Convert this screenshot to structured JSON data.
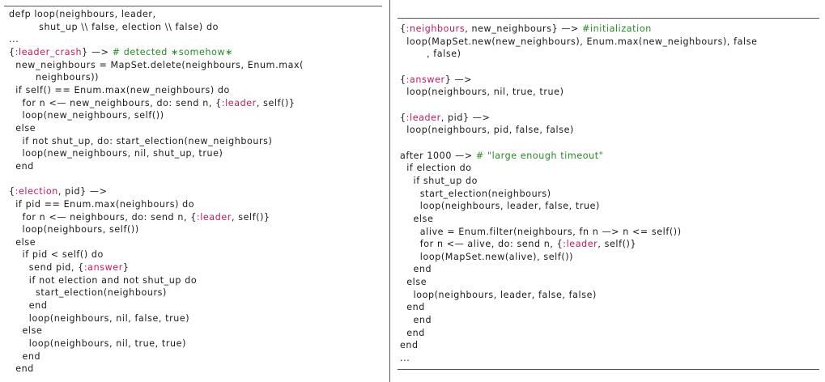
{
  "left_listing": {
    "lines": [
      [
        {
          "t": "defp loop(neighbours, leader,"
        }
      ],
      [
        {
          "t": "         shut_up \\\\ false, election \\\\ false) do"
        }
      ],
      [
        {
          "t": "..."
        }
      ],
      [
        {
          "t": "{"
        },
        {
          "t": ":leader_crash",
          "c": "atom"
        },
        {
          "t": "} —> "
        },
        {
          "t": "# detected ∗somehow∗",
          "c": "cm"
        }
      ],
      [
        {
          "t": "  new_neighbours = MapSet.delete(neighbours, Enum.max("
        }
      ],
      [
        {
          "t": "        neighbours))"
        }
      ],
      [
        {
          "t": "  if self() == Enum.max(new_neighbours) do"
        }
      ],
      [
        {
          "t": "    for n <— new_neighbours, do: send n, {"
        },
        {
          "t": ":leader",
          "c": "atom"
        },
        {
          "t": ", self()}"
        }
      ],
      [
        {
          "t": "    loop(new_neighbours, self())"
        }
      ],
      [
        {
          "t": "  else"
        }
      ],
      [
        {
          "t": "    if not shut_up, do: start_election(new_neighbours)"
        }
      ],
      [
        {
          "t": "    loop(new_neighbours, nil, shut_up, true)"
        }
      ],
      [
        {
          "t": "  end"
        }
      ],
      [
        {
          "t": ""
        }
      ],
      [
        {
          "t": "{"
        },
        {
          "t": ":election",
          "c": "atom"
        },
        {
          "t": ", pid} —>"
        }
      ],
      [
        {
          "t": "  if pid == Enum.max(neighbours) do"
        }
      ],
      [
        {
          "t": "    for n <— neighbours, do: send n, {"
        },
        {
          "t": ":leader",
          "c": "atom"
        },
        {
          "t": ", self()}"
        }
      ],
      [
        {
          "t": "    loop(neighbours, self())"
        }
      ],
      [
        {
          "t": "  else"
        }
      ],
      [
        {
          "t": "    if pid < self() do"
        }
      ],
      [
        {
          "t": "      send pid, {"
        },
        {
          "t": ":answer",
          "c": "atom"
        },
        {
          "t": "}"
        }
      ],
      [
        {
          "t": "      if not election and not shut_up do"
        }
      ],
      [
        {
          "t": "        start_election(neighbours)"
        }
      ],
      [
        {
          "t": "      end"
        }
      ],
      [
        {
          "t": "      loop(neighbours, nil, false, true)"
        }
      ],
      [
        {
          "t": "    else"
        }
      ],
      [
        {
          "t": "      loop(neighbours, nil, true, true)"
        }
      ],
      [
        {
          "t": "    end"
        }
      ],
      [
        {
          "t": "  end"
        }
      ]
    ]
  },
  "right_listing": {
    "lines": [
      [
        {
          "t": "{"
        },
        {
          "t": ":neighbours",
          "c": "atom"
        },
        {
          "t": ", new_neighbours} —> "
        },
        {
          "t": "#initialization",
          "c": "cm"
        }
      ],
      [
        {
          "t": "  loop(MapSet.new(new_neighbours), Enum.max(new_neighbours), false"
        }
      ],
      [
        {
          "t": "        , false)"
        }
      ],
      [
        {
          "t": ""
        }
      ],
      [
        {
          "t": "{"
        },
        {
          "t": ":answer",
          "c": "atom"
        },
        {
          "t": "} —>"
        }
      ],
      [
        {
          "t": "  loop(neighbours, nil, true, true)"
        }
      ],
      [
        {
          "t": ""
        }
      ],
      [
        {
          "t": "{"
        },
        {
          "t": ":leader",
          "c": "atom"
        },
        {
          "t": ", pid} —>"
        }
      ],
      [
        {
          "t": "  loop(neighbours, pid, false, false)"
        }
      ],
      [
        {
          "t": ""
        }
      ],
      [
        {
          "t": "after 1000 —> "
        },
        {
          "t": "# \"large enough timeout\"",
          "c": "cm"
        }
      ],
      [
        {
          "t": "  if election do"
        }
      ],
      [
        {
          "t": "    if shut_up do"
        }
      ],
      [
        {
          "t": "      start_election(neighbours)"
        }
      ],
      [
        {
          "t": "      loop(neighbours, leader, false, true)"
        }
      ],
      [
        {
          "t": "    else"
        }
      ],
      [
        {
          "t": "      alive = Enum.filter(neighbours, fn n —> n <= self())"
        }
      ],
      [
        {
          "t": "      for n <— alive, do: send n, {"
        },
        {
          "t": ":leader",
          "c": "atom"
        },
        {
          "t": ", self()}"
        }
      ],
      [
        {
          "t": "      loop(MapSet.new(alive), self())"
        }
      ],
      [
        {
          "t": "    end"
        }
      ],
      [
        {
          "t": "  else"
        }
      ],
      [
        {
          "t": "    loop(neighbours, leader, false, false)"
        }
      ],
      [
        {
          "t": "  end"
        }
      ],
      [
        {
          "t": "    end"
        }
      ],
      [
        {
          "t": "  end"
        }
      ],
      [
        {
          "t": "end"
        }
      ],
      [
        {
          "t": "..."
        }
      ]
    ]
  }
}
